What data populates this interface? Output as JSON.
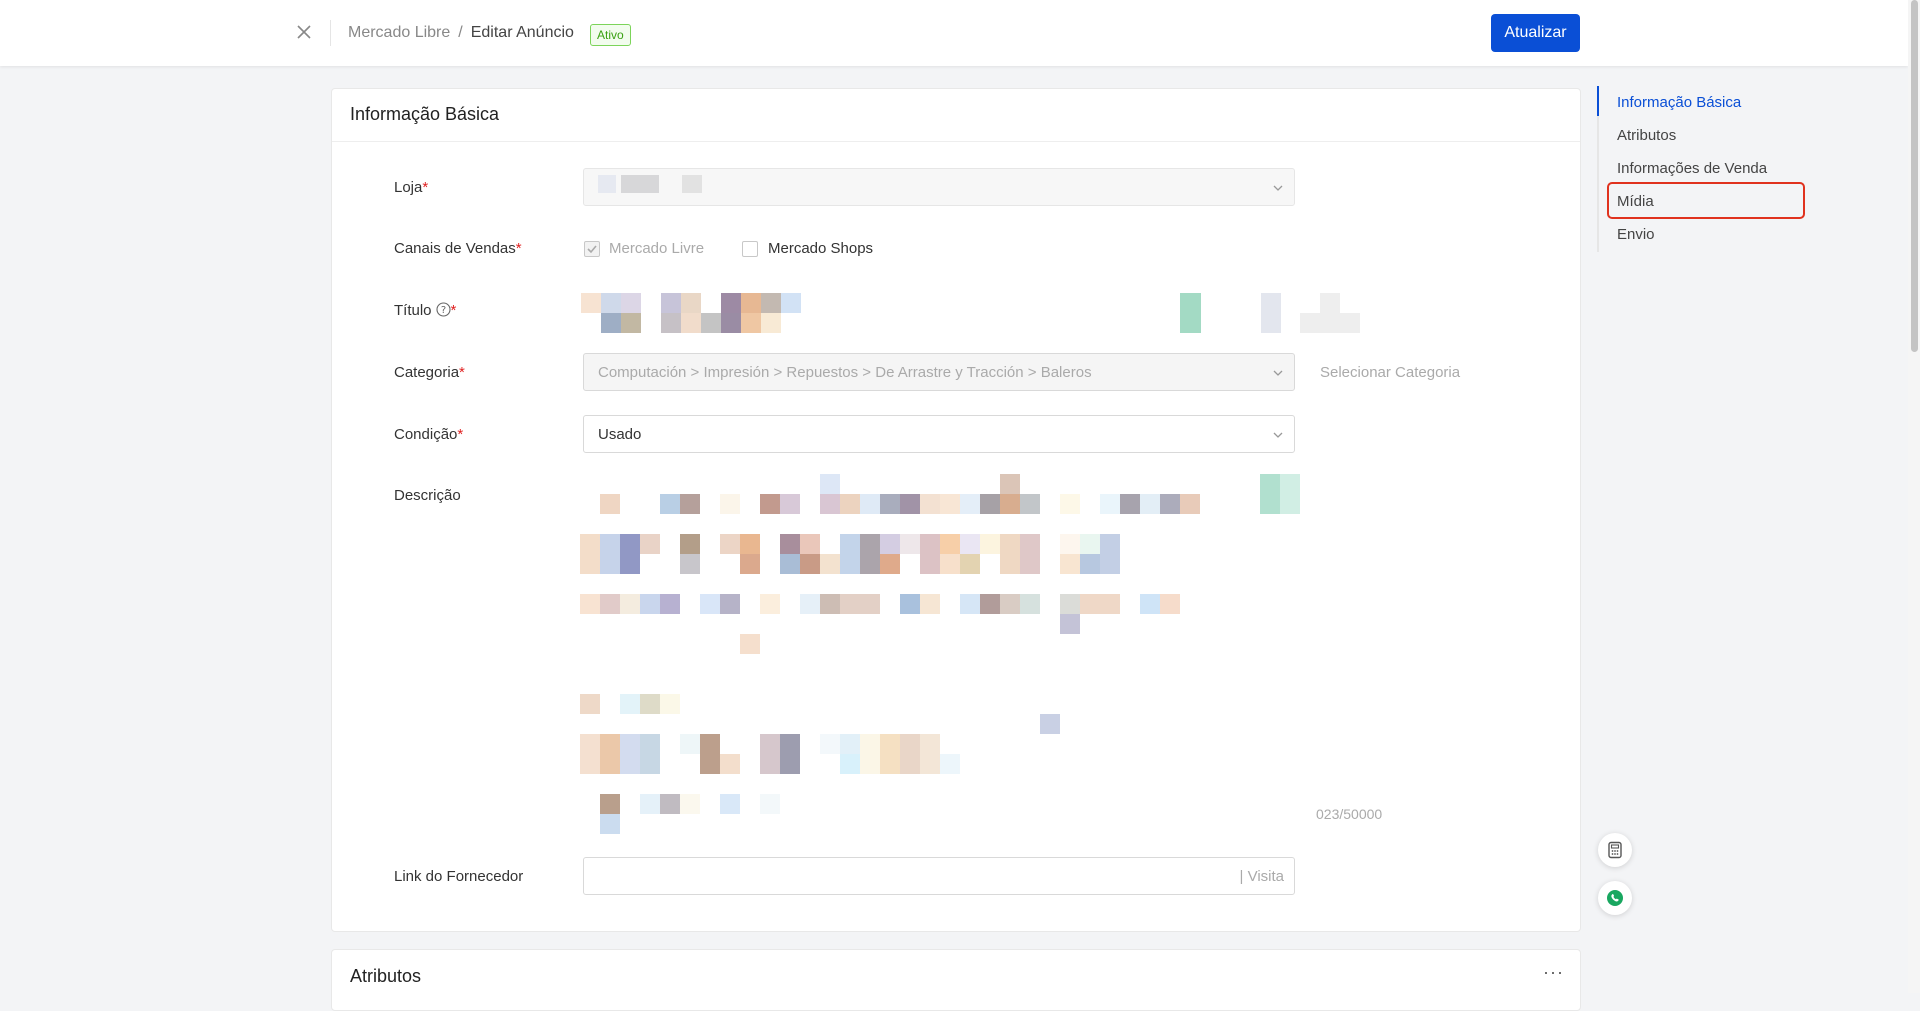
{
  "header": {
    "breadcrumb_root": "Mercado Libre",
    "breadcrumb_separator": "/",
    "breadcrumb_current": "Editar Anúncio",
    "status_badge": "Ativo",
    "update_button": "Atualizar"
  },
  "basic_info": {
    "section_title": "Informação Básica",
    "store": {
      "label": "Loja",
      "required_mark": "*"
    },
    "sales_channels": {
      "label": "Canais de Vendas",
      "required_mark": "*",
      "options": [
        {
          "label": "Mercado Livre",
          "checked": true,
          "disabled": true
        },
        {
          "label": "Mercado Shops",
          "checked": false,
          "disabled": false
        }
      ]
    },
    "title": {
      "label": "Título",
      "required_mark": "*"
    },
    "category": {
      "label": "Categoria",
      "required_mark": "*",
      "value": "Computación > Impresión > Repuestos > De Arrastre y Tracción > Baleros",
      "select_link": "Selecionar Categoria"
    },
    "condition": {
      "label": "Condição",
      "required_mark": "*",
      "value": "Usado"
    },
    "description": {
      "label": "Descrição",
      "counter": "023/50000"
    },
    "supplier_link": {
      "label": "Link do Fornecedor",
      "value": "",
      "suffix": "| Visita"
    }
  },
  "attributes_section": {
    "section_title": "Atributos",
    "more_label": "···"
  },
  "anchor_nav": {
    "items": [
      {
        "label": "Informação Básica",
        "active": true
      },
      {
        "label": "Atributos",
        "active": false
      },
      {
        "label": "Informações de Venda",
        "active": false
      },
      {
        "label": "Mídia",
        "active": false,
        "highlighted": true
      },
      {
        "label": "Envio",
        "active": false
      }
    ]
  },
  "floating_buttons": {
    "icons": [
      "calculator-icon",
      "whatsapp-icon"
    ]
  },
  "colors": {
    "primary": "#0a4fd6",
    "required": "#e02020",
    "active_badge": "#3aa112",
    "highlight_box": "#e0321e"
  }
}
